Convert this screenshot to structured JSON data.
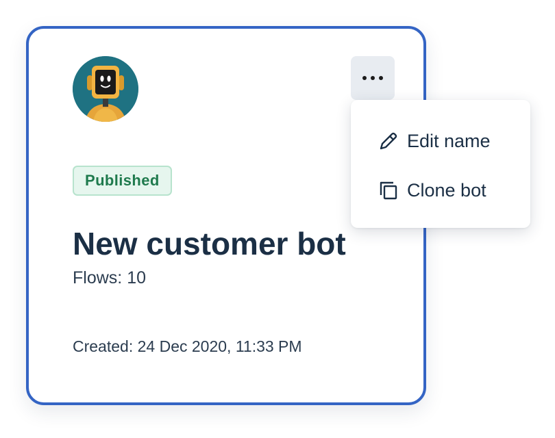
{
  "card": {
    "status_badge": "Published",
    "title": "New customer bot",
    "flows_label": "Flows:",
    "flows_count": "10",
    "created_label": "Created:",
    "created_value": "24 Dec 2020, 11:33 PM"
  },
  "menu": {
    "items": [
      {
        "label": "Edit name",
        "icon": "pencil-icon"
      },
      {
        "label": "Clone bot",
        "icon": "copy-icon"
      }
    ]
  },
  "icons": {
    "more": "more-horizontal-icon",
    "avatar": "robot-avatar"
  },
  "colors": {
    "card_border": "#3464c4",
    "title_text": "#1b2f45",
    "badge_text": "#1f7a4d",
    "badge_background": "#e6f6ee",
    "badge_border": "#b7e3cd",
    "more_button_background": "#e8ecf1"
  }
}
